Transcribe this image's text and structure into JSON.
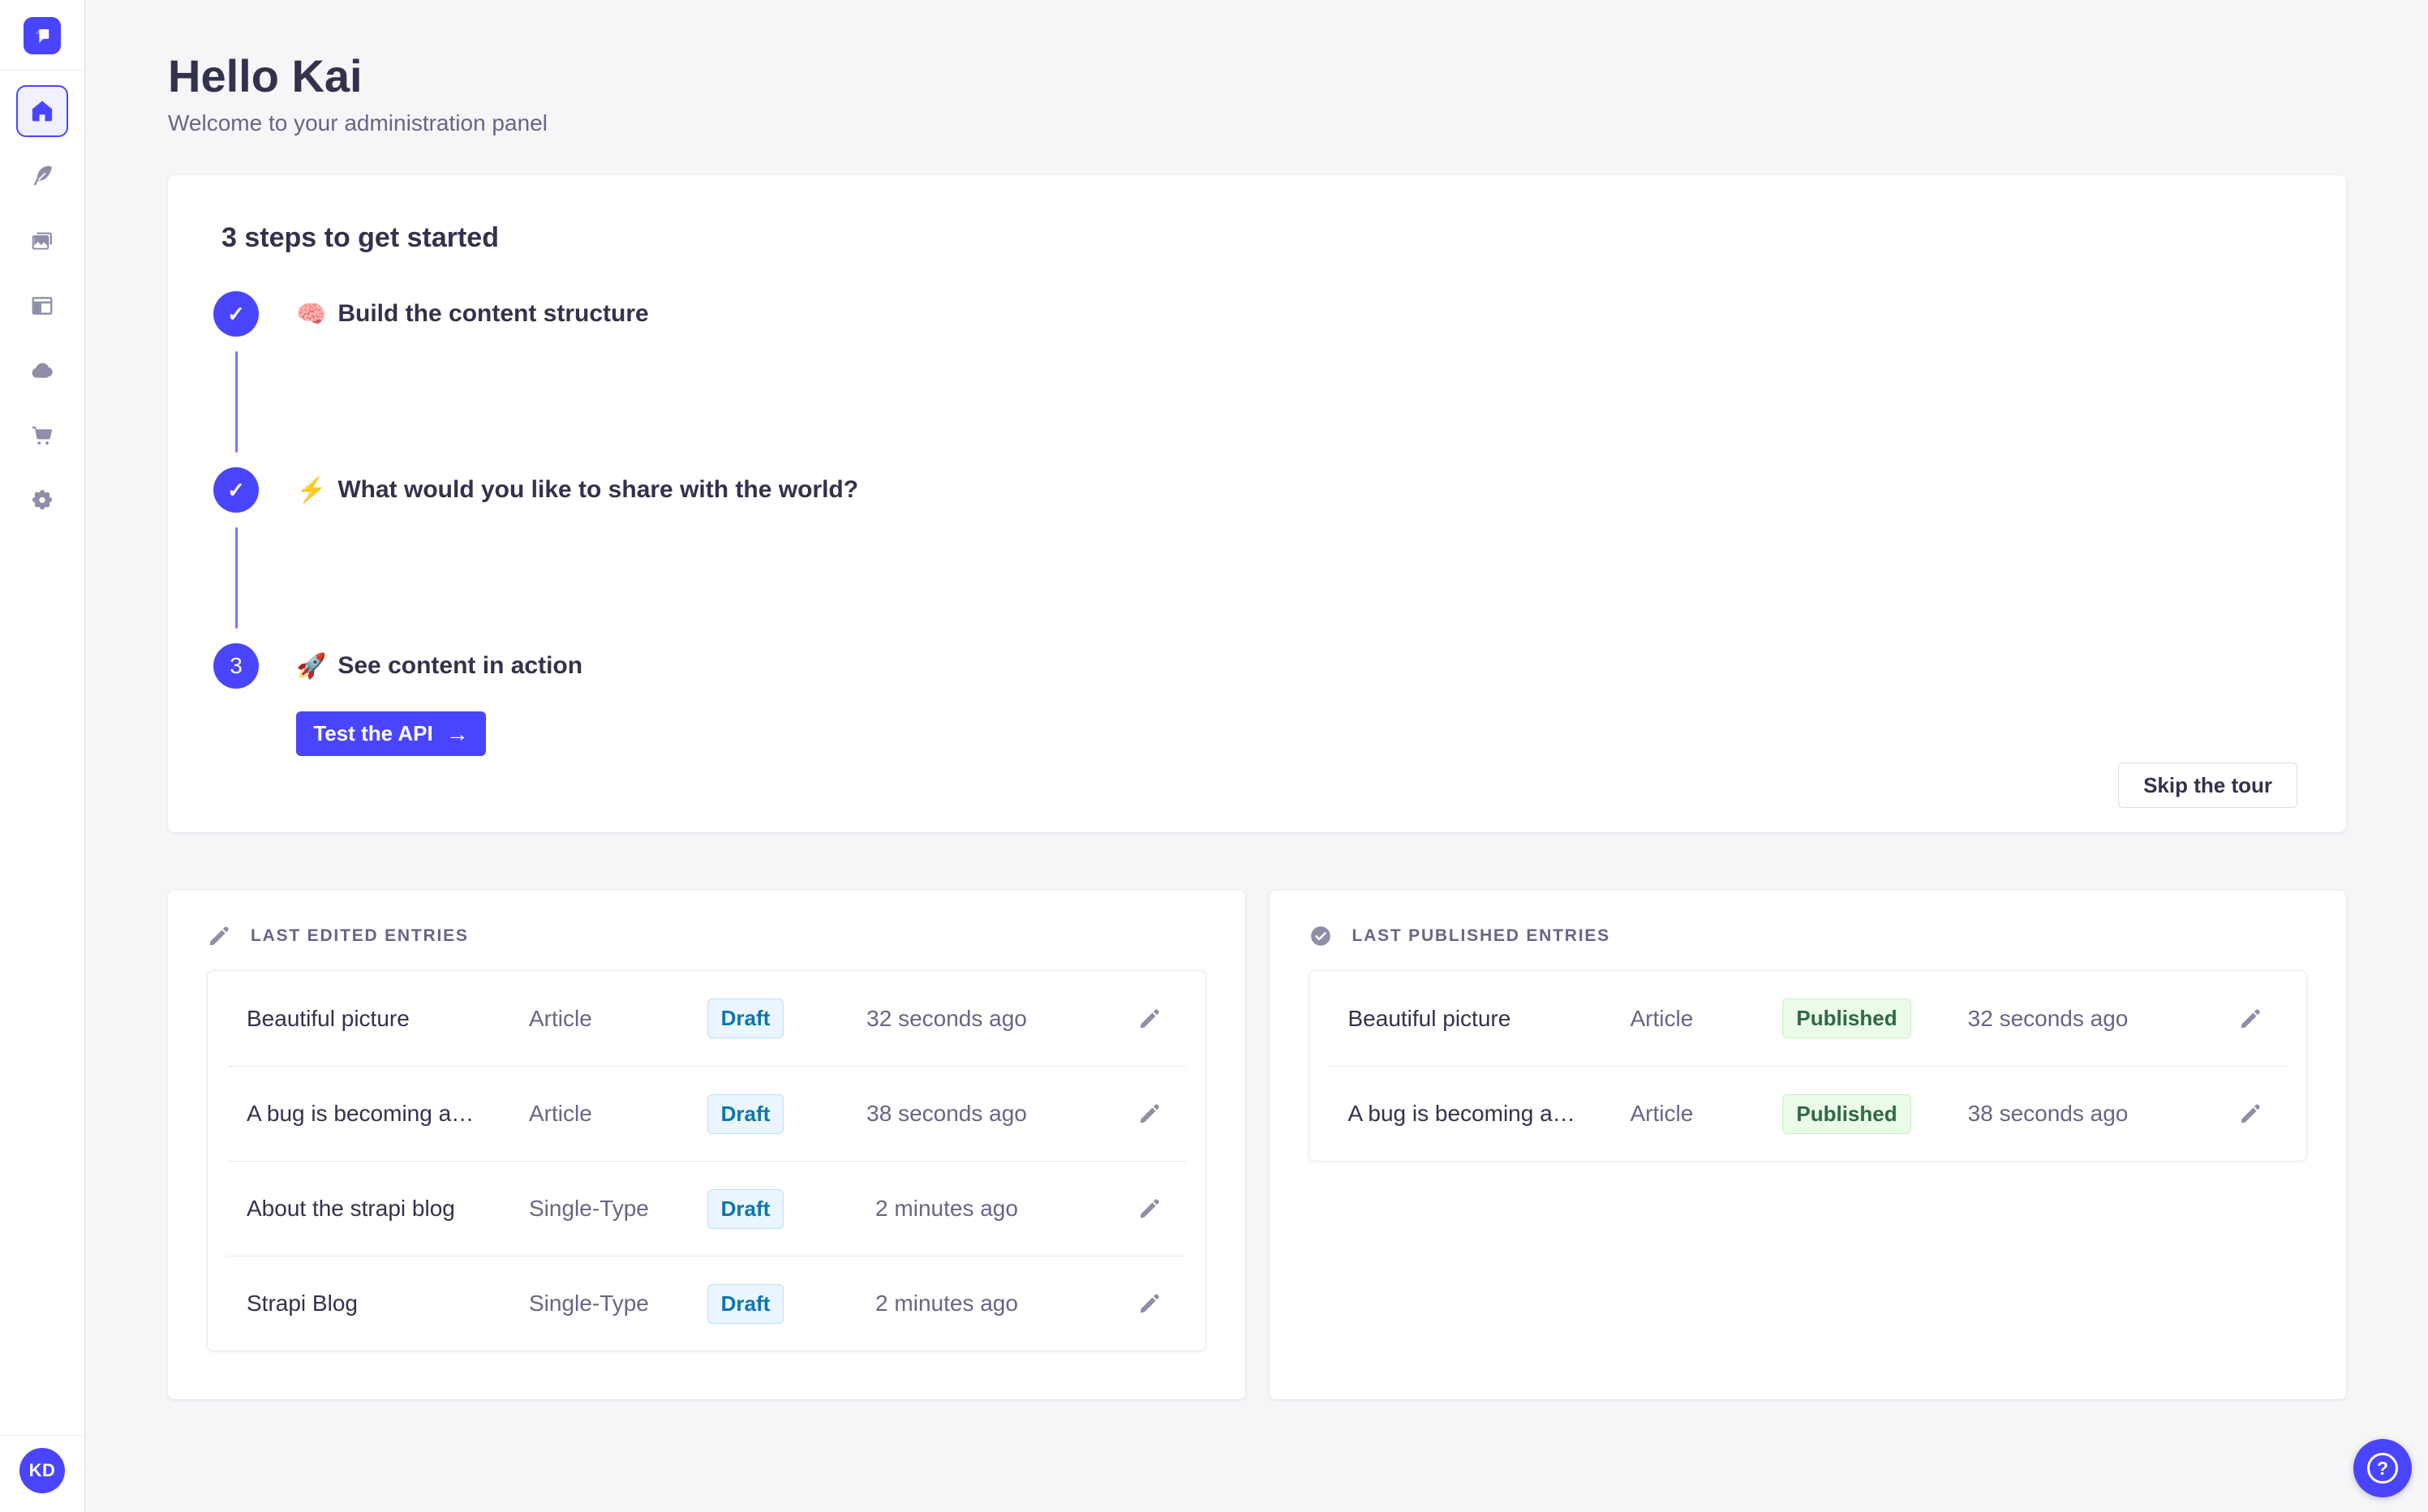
{
  "colors": {
    "accent": "#4945ff",
    "accent_light": "#7b79ff",
    "draft_text": "#0c75af",
    "draft_bg": "#eaf5ff",
    "published_text": "#2f6846",
    "published_bg": "#eafbe7",
    "background": "#f6f6f9"
  },
  "sidebar": {
    "logo_icon": "strapi-logo",
    "nav_icons": [
      "home-icon",
      "feather-icon",
      "images-icon",
      "layout-icon",
      "cloud-icon",
      "cart-icon",
      "gear-icon"
    ],
    "avatar_initials": "KD"
  },
  "header": {
    "title": "Hello Kai",
    "subtitle": "Welcome to your administration panel"
  },
  "guided_tour": {
    "title": "3 steps to get started",
    "steps": [
      {
        "state": "done",
        "check": "✓",
        "emoji": "🧠",
        "label": "Build the content structure"
      },
      {
        "state": "done",
        "check": "✓",
        "emoji": "⚡",
        "label": "What would you like to share with the world?"
      },
      {
        "state": "current",
        "number": "3",
        "emoji": "🚀",
        "label": "See content in action",
        "cta_label": "Test the API",
        "cta_arrow": "→"
      }
    ],
    "skip_label": "Skip the tour"
  },
  "last_edited": {
    "title": "LAST EDITED ENTRIES",
    "rows": [
      {
        "title": "Beautiful picture",
        "kind": "Article",
        "status": "Draft",
        "time": "32 seconds ago"
      },
      {
        "title": "A bug is becoming a…",
        "kind": "Article",
        "status": "Draft",
        "time": "38 seconds ago"
      },
      {
        "title": "About the strapi blog",
        "kind": "Single-Type",
        "status": "Draft",
        "time": "2 minutes ago"
      },
      {
        "title": "Strapi Blog",
        "kind": "Single-Type",
        "status": "Draft",
        "time": "2 minutes ago"
      }
    ]
  },
  "last_published": {
    "title": "LAST PUBLISHED ENTRIES",
    "rows": [
      {
        "title": "Beautiful picture",
        "kind": "Article",
        "status": "Published",
        "time": "32 seconds ago"
      },
      {
        "title": "A bug is becoming a…",
        "kind": "Article",
        "status": "Published",
        "time": "38 seconds ago"
      }
    ]
  },
  "help": {
    "label": "?"
  }
}
